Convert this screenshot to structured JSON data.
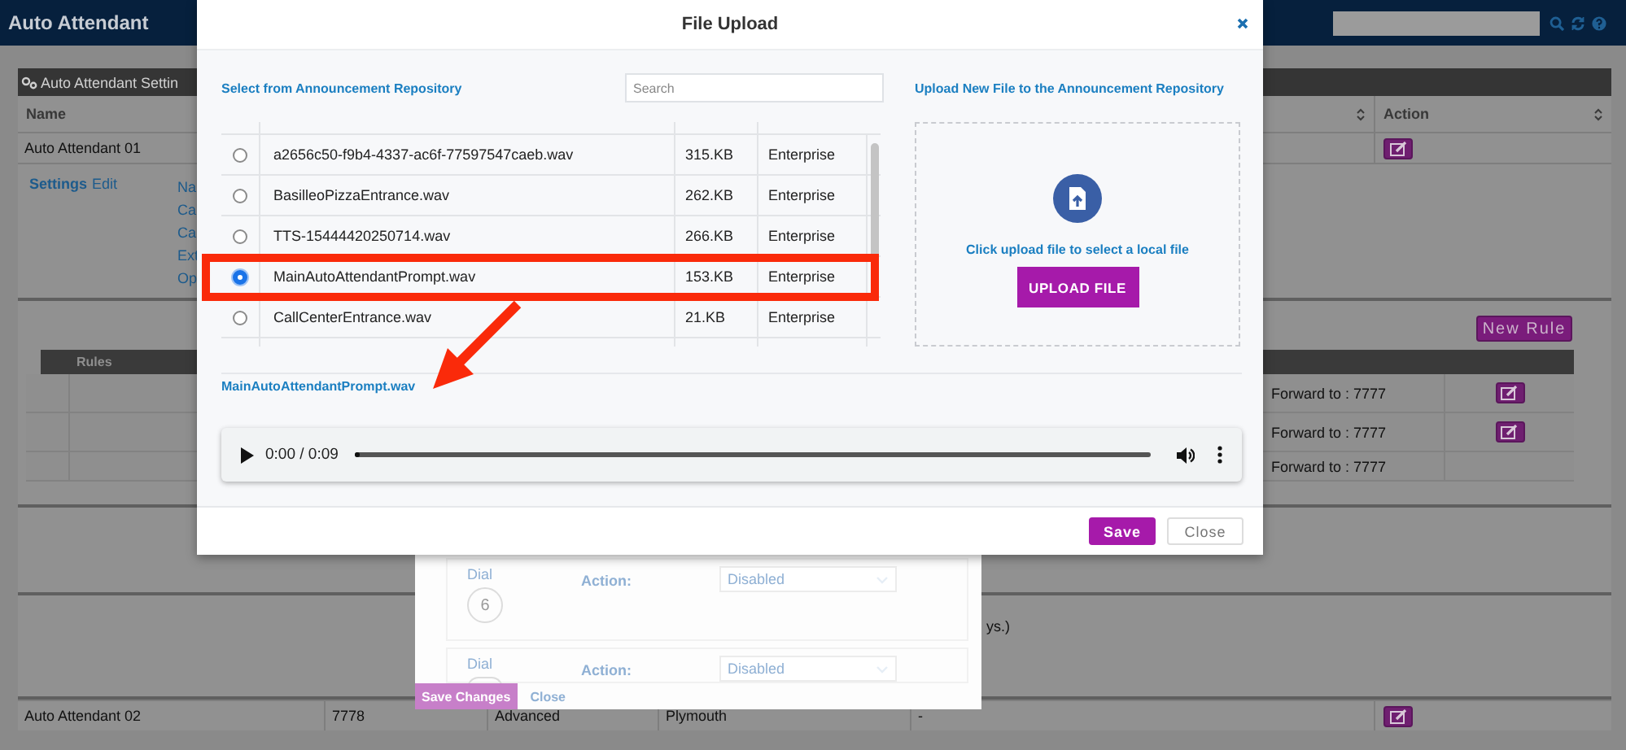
{
  "app_bar": {
    "title": "Auto Attendant"
  },
  "settings_panel": {
    "title": "Auto Attendant Settin",
    "columns": [
      "Name",
      "Action"
    ],
    "attendants": [
      {
        "name": "Auto Attendant 01"
      },
      {
        "name": "Auto Attendant 02",
        "cells": [
          "7778",
          "Advanced",
          "Plymouth",
          "-"
        ]
      }
    ],
    "settings": {
      "label": "Settings",
      "edit": "Edit",
      "fields": [
        "Na",
        "Ca",
        "Ca",
        "Ext",
        "Op"
      ]
    },
    "rules": {
      "new_rule": "New Rule",
      "header": "Rules",
      "rows": [
        {
          "text": "Forward to : 7777",
          "editable": true
        },
        {
          "text": "Forward to : 7777",
          "editable": true
        },
        {
          "text": "Forward to : 7777",
          "editable": false
        }
      ]
    },
    "note_fragment": "ys.)"
  },
  "background_dialog": {
    "entries": [
      {
        "dial": "Dial",
        "key": "6",
        "action": "Action:",
        "value": "Disabled"
      },
      {
        "dial": "Dial",
        "action": "Action:",
        "value": "Disabled"
      }
    ],
    "save": "Save Changes",
    "close": "Close"
  },
  "file_upload": {
    "title": "File Upload",
    "repository_heading": "Select from Announcement Repository",
    "search_placeholder": "Search",
    "files": [
      {
        "name": "a2656c50-f9b4-4337-ac6f-77597547caeb.wav",
        "size": "315.KB",
        "scope": "Enterprise",
        "selected": false
      },
      {
        "name": "BasilleoPizzaEntrance.wav",
        "size": "262.KB",
        "scope": "Enterprise",
        "selected": false
      },
      {
        "name": "TTS-15444420250714.wav",
        "size": "266.KB",
        "scope": "Enterprise",
        "selected": false
      },
      {
        "name": "MainAutoAttendantPrompt.wav",
        "size": "153.KB",
        "scope": "Enterprise",
        "selected": true
      },
      {
        "name": "CallCenterEntrance.wav",
        "size": "21.KB",
        "scope": "Enterprise",
        "selected": false
      }
    ],
    "upload_heading": "Upload New File to the Announcement Repository",
    "upload_hint": "Click upload file to select a local file",
    "upload_button": "UPLOAD FILE",
    "selected_file": "MainAutoAttendantPrompt.wav",
    "player": {
      "time": "0:00 / 0:09",
      "level": 0
    },
    "save": "Save",
    "close": "Close",
    "annotations": {
      "highlight_box": true,
      "arrow": true
    }
  }
}
